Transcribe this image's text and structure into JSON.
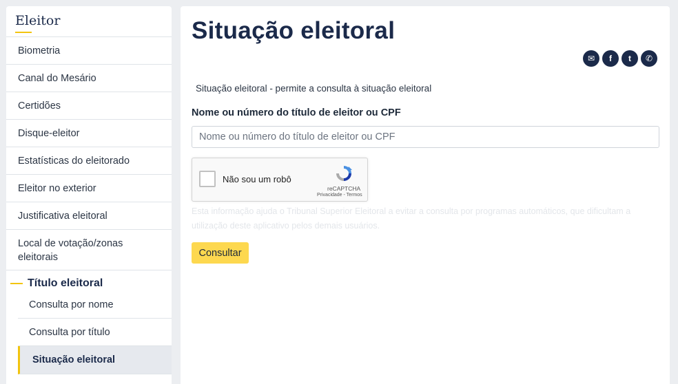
{
  "sidebar": {
    "title": "Eleitor",
    "items": [
      {
        "label": "Biometria"
      },
      {
        "label": "Canal do Mesário"
      },
      {
        "label": "Certidões"
      },
      {
        "label": "Disque-eleitor"
      },
      {
        "label": "Estatísticas do eleitorado"
      },
      {
        "label": "Eleitor no exterior"
      },
      {
        "label": "Justificativa eleitoral"
      },
      {
        "label": "Local de votação/zonas eleitorais"
      }
    ],
    "group": {
      "label": "Título eleitoral",
      "subitems": [
        {
          "label": "Consulta por nome"
        },
        {
          "label": "Consulta por título"
        },
        {
          "label": "Situação eleitoral",
          "active": true
        }
      ]
    }
  },
  "main": {
    "title": "Situação eleitoral",
    "share": [
      {
        "icon": "envelope-icon",
        "glyph": "✉"
      },
      {
        "icon": "facebook-icon",
        "glyph": "f"
      },
      {
        "icon": "twitter-icon",
        "glyph": "t"
      },
      {
        "icon": "whatsapp-icon",
        "glyph": "✆"
      }
    ],
    "description": "Situação eleitoral - permite a consulta à situação eleitoral",
    "field_label": "Nome ou número do título de eleitor ou CPF",
    "input": {
      "value": "",
      "placeholder": "Nome ou número do título de eleitor ou CPF"
    },
    "captcha": {
      "label": "Não sou um robô",
      "brand": "reCAPTCHA",
      "links": "Privacidade - Termos"
    },
    "hint": "Esta informação ajuda o Tribunal Superior Eleitoral a evitar a consulta por programas automáticos, que dificultam a utilização deste aplicativo pelos demais usuários.",
    "submit_label": "Consultar"
  },
  "colors": {
    "accent": "#f2c40f",
    "button": "#fdd84f",
    "navy": "#1b2a4a",
    "background": "#eceef1"
  }
}
